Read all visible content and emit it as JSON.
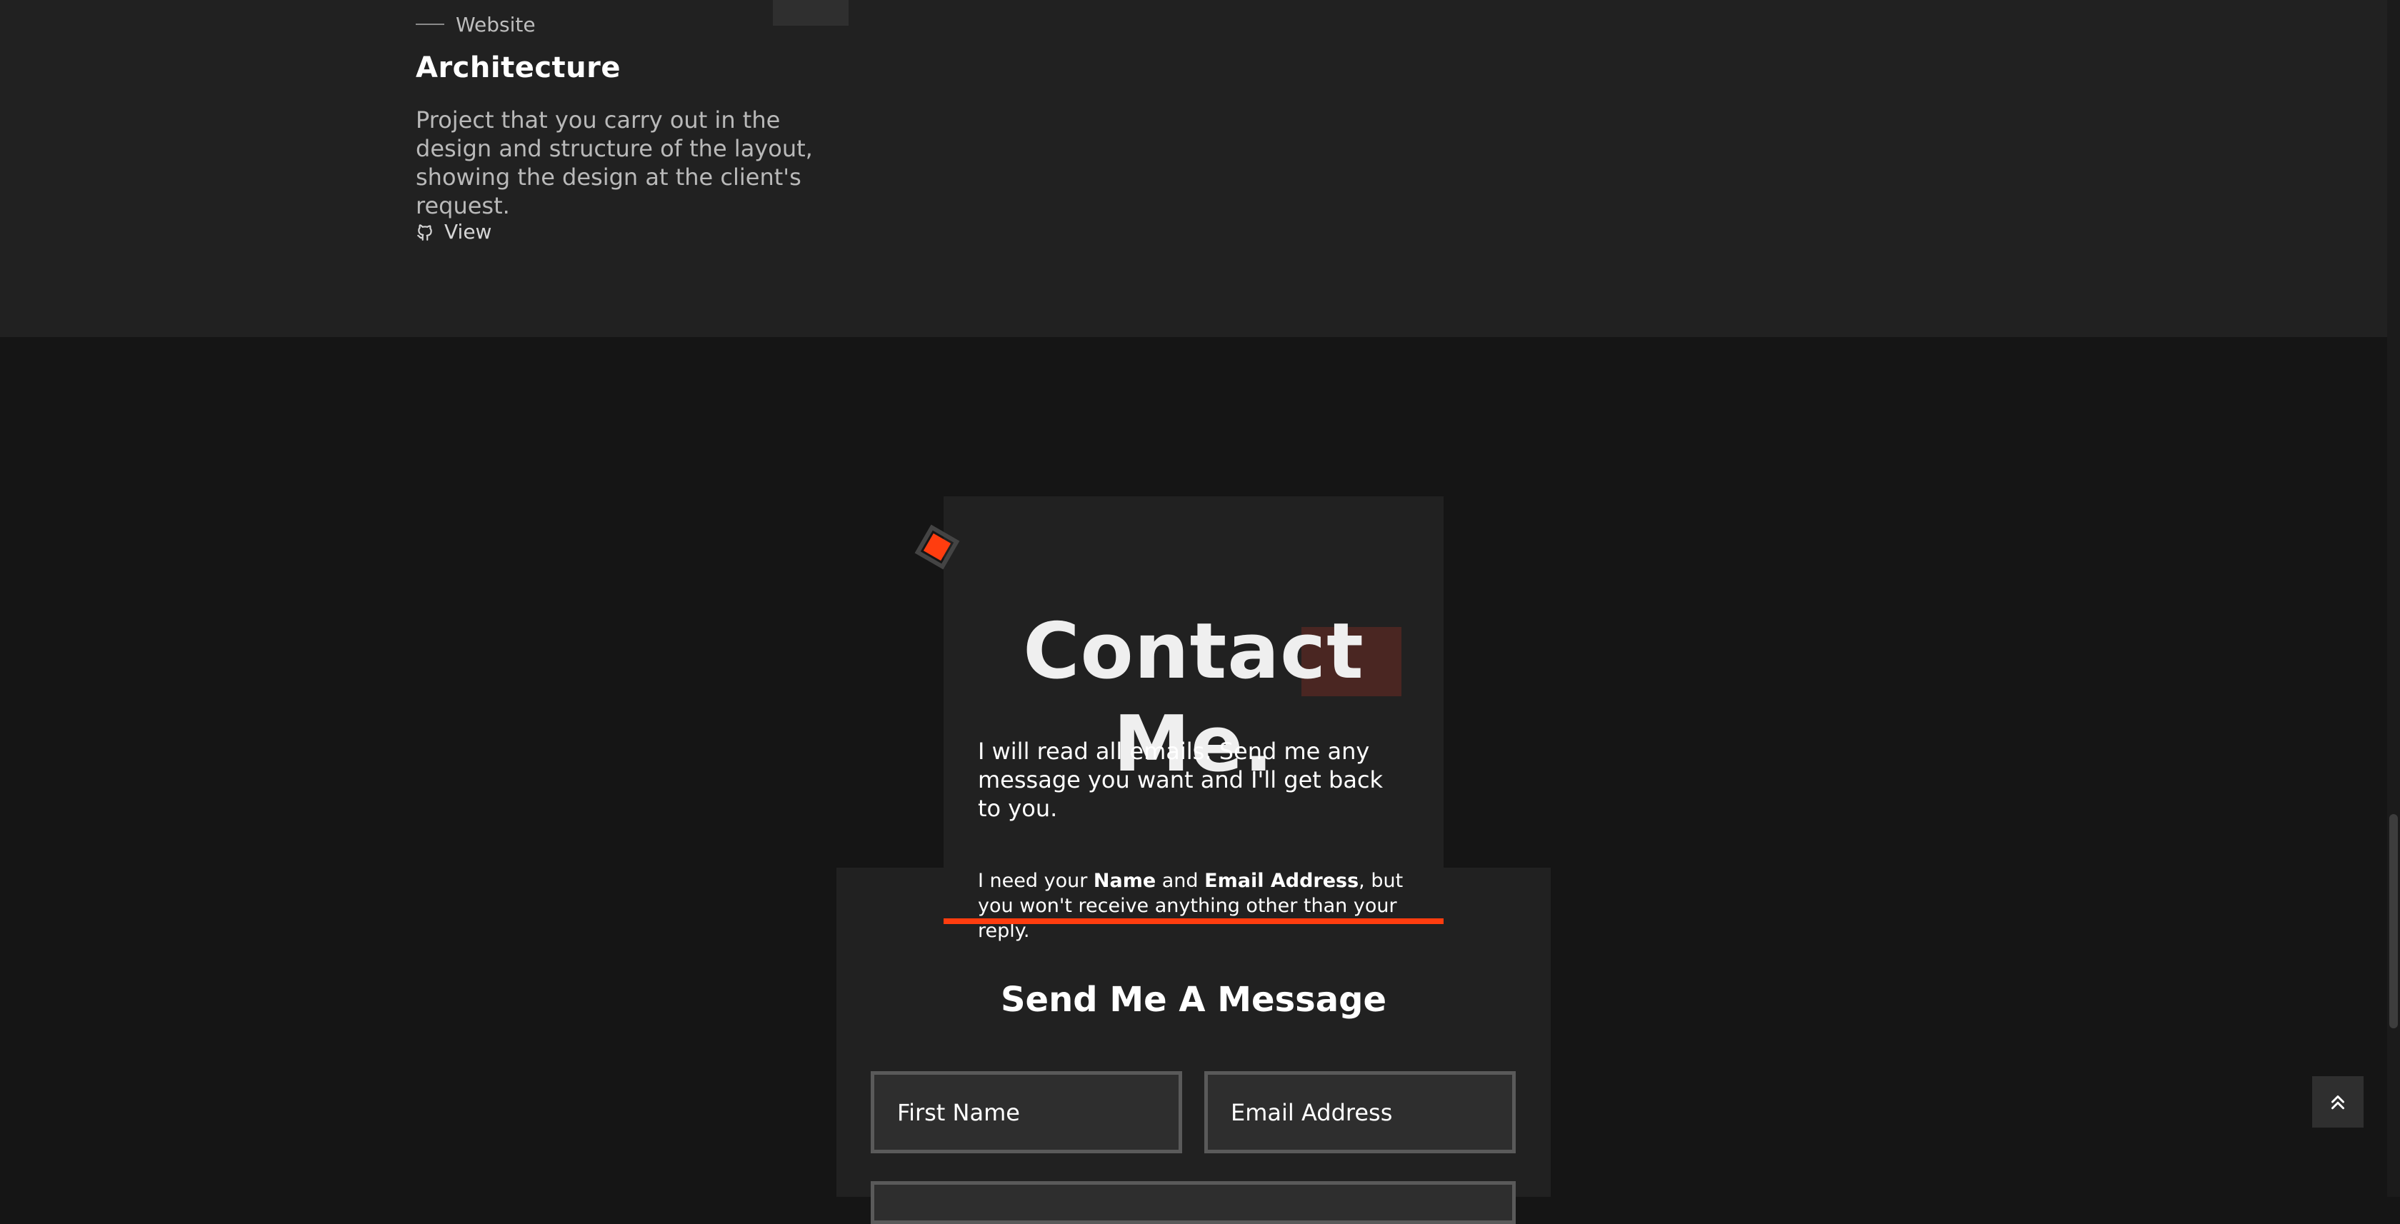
{
  "project": {
    "category": "Website",
    "title": "Architecture",
    "description": "Project that you carry out in the design and structure of the layout, showing the design at the client's request.",
    "view_label": "View",
    "view_icon": "github-icon"
  },
  "contact": {
    "title": "Contact Me.",
    "intro": "I will read all emails. Send me any message you want and I'll get back to you.",
    "note_part1": "I need your ",
    "note_name": "Name",
    "note_part2": " and ",
    "note_email": "Email Address",
    "note_part3": ", but you won't receive anything other than your reply.",
    "decor_icon": "diamond-icon"
  },
  "form": {
    "heading": "Send Me A Message",
    "first_name_placeholder": "First Name",
    "email_placeholder": "Email Address"
  },
  "back_to_top_icon": "double-chevron-up-icon",
  "colors": {
    "accent": "#ff3d0f",
    "section_bg": "#212121",
    "page_bg": "#151515",
    "highlight": "#4a2622"
  }
}
